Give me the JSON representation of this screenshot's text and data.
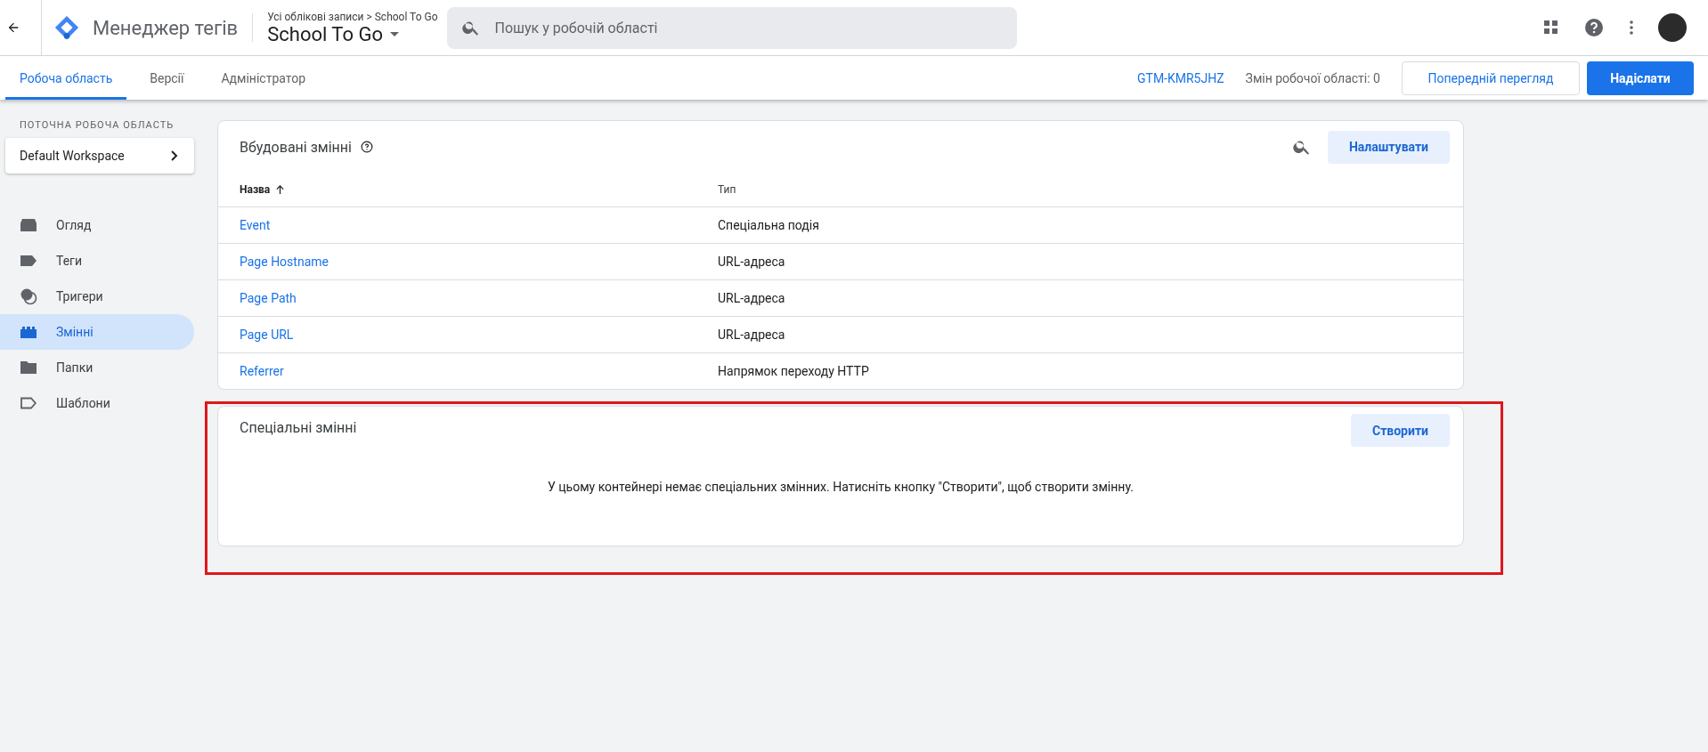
{
  "header": {
    "app_title": "Менеджер тегів",
    "breadcrumb": "Усі облікові записи > School To Go",
    "container_name": "School To Go",
    "search": {
      "placeholder": "Пошук у робочій області"
    }
  },
  "tabs": [
    {
      "label": "Робоча область",
      "selected": true
    },
    {
      "label": "Версії",
      "selected": false
    },
    {
      "label": "Адміністратор",
      "selected": false
    }
  ],
  "toolbar": {
    "container_id": "GTM-KMR5JHZ",
    "changes": "Змін робочої області: 0",
    "preview_button": "Попередній перегляд",
    "submit_button": "Надіслати"
  },
  "sidebar": {
    "section_label": "ПОТОЧНА РОБОЧА ОБЛАСТЬ",
    "workspace": "Default Workspace",
    "items": [
      {
        "label": "Огляд",
        "kind": "overview",
        "selected": false
      },
      {
        "label": "Теги",
        "kind": "tags",
        "selected": false
      },
      {
        "label": "Тригери",
        "kind": "triggers",
        "selected": false
      },
      {
        "label": "Змінні",
        "kind": "variables",
        "selected": true
      },
      {
        "label": "Папки",
        "kind": "folders",
        "selected": false
      },
      {
        "label": "Шаблони",
        "kind": "templates",
        "selected": false
      }
    ]
  },
  "builtin_variables": {
    "title": "Вбудовані змінні",
    "configure_button": "Налаштувати",
    "columns": [
      "Назва",
      "Тип"
    ],
    "rows": [
      {
        "name": "Event",
        "type": "Спеціальна подія"
      },
      {
        "name": "Page Hostname",
        "type": "URL-адреса"
      },
      {
        "name": "Page Path",
        "type": "URL-адреса"
      },
      {
        "name": "Page URL",
        "type": "URL-адреса"
      },
      {
        "name": "Referrer",
        "type": "Напрямок переходу HTTP"
      }
    ]
  },
  "user_variables": {
    "title": "Спеціальні змінні",
    "create_button": "Створити",
    "empty_message": "У цьому контейнері немає спеціальних змінних. Натисніть кнопку \"Створити\", щоб створити змінну."
  }
}
